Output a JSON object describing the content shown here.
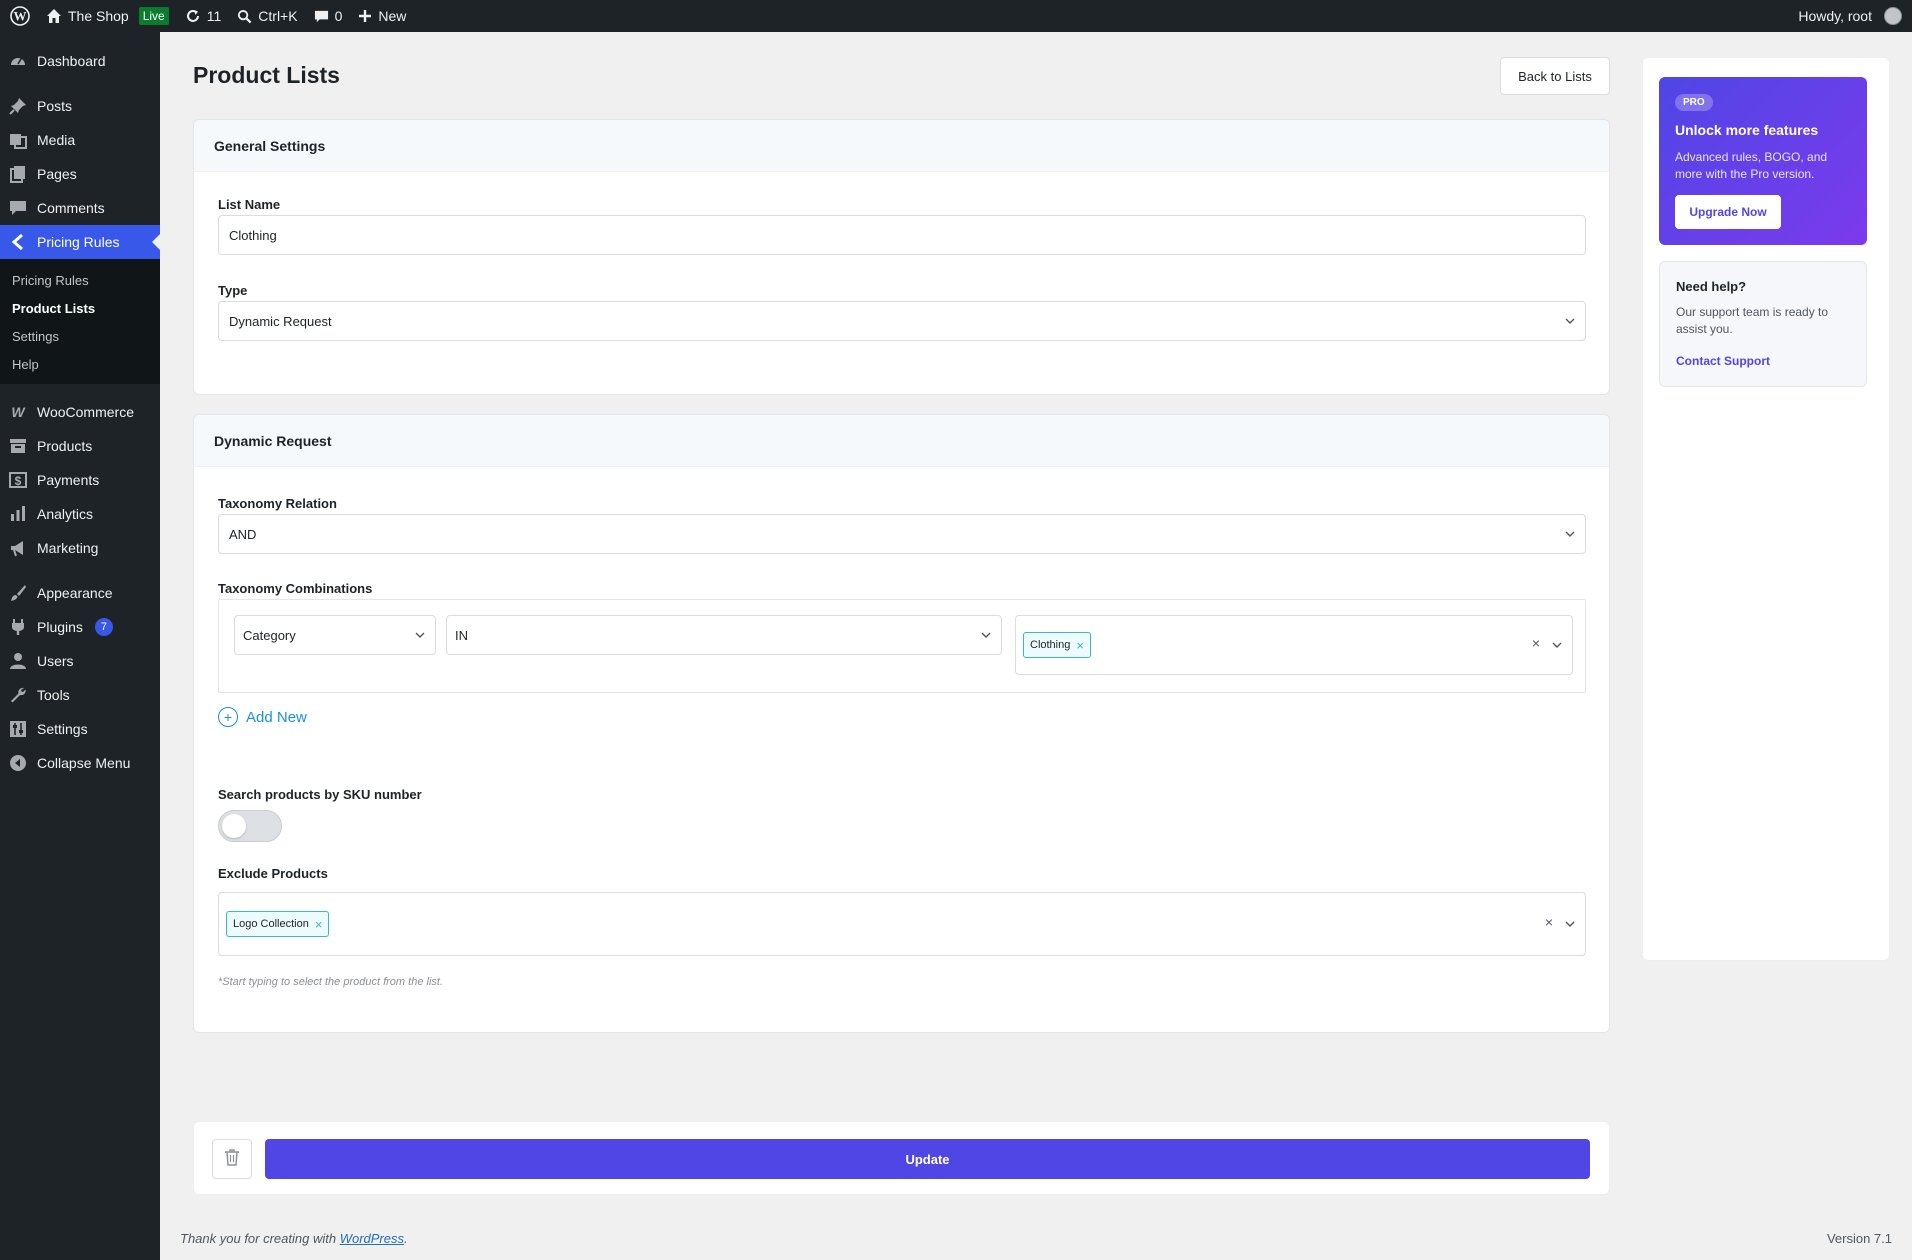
{
  "adminbar": {
    "site_name": "The Shop",
    "live_label": "Live",
    "updates_count": "11",
    "search_shortcut": "Ctrl+K",
    "comments_count": "0",
    "new_label": "New",
    "greeting": "Howdy, root"
  },
  "sidebar": {
    "items": [
      {
        "label": "Dashboard",
        "icon": "dashboard-icon"
      },
      {
        "label": "Posts",
        "icon": "pin-icon"
      },
      {
        "label": "Media",
        "icon": "media-icon"
      },
      {
        "label": "Pages",
        "icon": "pages-icon"
      },
      {
        "label": "Comments",
        "icon": "comment-icon"
      },
      {
        "label": "Pricing Rules",
        "icon": "chevron-left-icon"
      }
    ],
    "submenu": [
      "Pricing Rules",
      "Product Lists",
      "Settings",
      "Help"
    ],
    "items2": [
      {
        "label": "WooCommerce",
        "icon": "woo-icon"
      },
      {
        "label": "Products",
        "icon": "archive-icon"
      },
      {
        "label": "Payments",
        "icon": "dollar-icon"
      },
      {
        "label": "Analytics",
        "icon": "bar-chart-icon"
      },
      {
        "label": "Marketing",
        "icon": "megaphone-icon"
      }
    ],
    "items3": [
      {
        "label": "Appearance",
        "icon": "brush-icon"
      },
      {
        "label": "Plugins",
        "icon": "plug-icon",
        "badge": "7"
      },
      {
        "label": "Users",
        "icon": "user-icon"
      },
      {
        "label": "Tools",
        "icon": "wrench-icon"
      },
      {
        "label": "Settings",
        "icon": "settings-icon"
      },
      {
        "label": "Collapse Menu",
        "icon": "collapse-icon"
      }
    ]
  },
  "page": {
    "title": "Product Lists",
    "back_label": "Back to Lists"
  },
  "general": {
    "header": "General Settings",
    "list_name_label": "List Name",
    "list_name_value": "Clothing",
    "type_label": "Type",
    "type_value": "Dynamic Request"
  },
  "dynamic": {
    "header": "Dynamic Request",
    "relation_label": "Taxonomy Relation",
    "relation_value": "AND",
    "combinations_label": "Taxonomy Combinations",
    "combo_taxonomy": "Category",
    "combo_operator": "IN",
    "combo_tag": "Clothing",
    "add_new_label": "Add New",
    "sku_label": "Search products by SKU number",
    "sku_enabled": false,
    "exclude_label": "Exclude Products",
    "exclude_tag": "Logo Collection",
    "helper_text": "*Start typing to select the product from the list."
  },
  "promo": {
    "badge": "PRO",
    "title": "Unlock more features",
    "description": "Advanced rules, BOGO, and more with the Pro version.",
    "button": "Upgrade Now"
  },
  "help": {
    "title": "Need help?",
    "description": "Our support team is ready to assist you.",
    "link": "Contact Support"
  },
  "actions": {
    "update_label": "Update"
  },
  "footer": {
    "thanks_prefix": "Thank you for creating with ",
    "thanks_link": "WordPress",
    "thanks_suffix": ".",
    "version": "Version 7.1"
  },
  "colors": {
    "accent": "#4f46e5",
    "menu_active": "#3858e9",
    "tag_border": "#36b9cc"
  }
}
